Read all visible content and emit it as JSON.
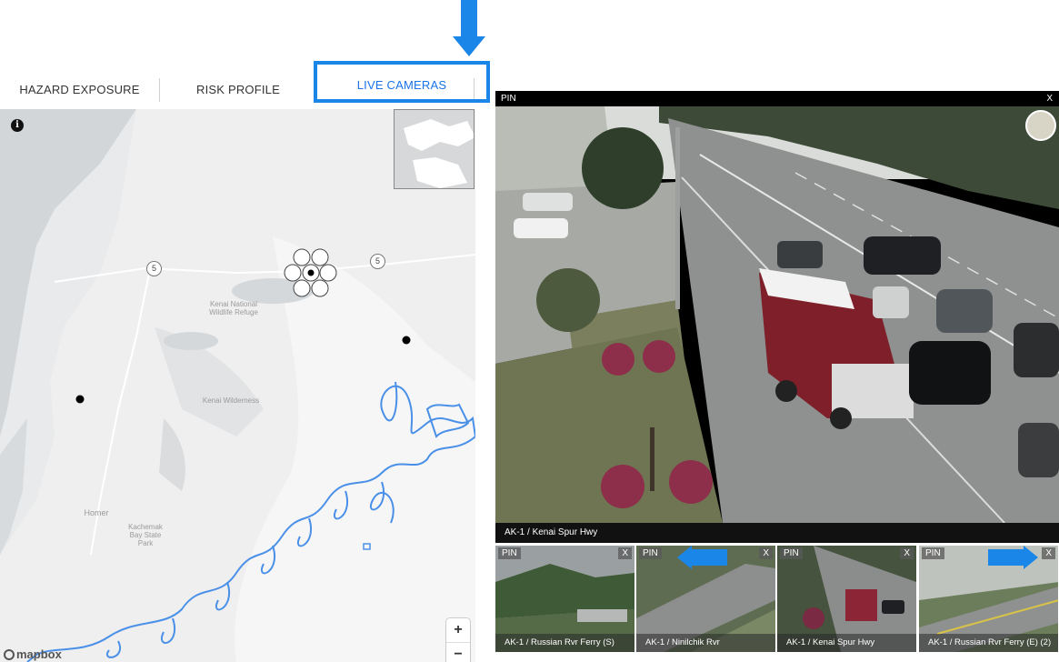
{
  "tabs": [
    {
      "label": "HAZARD EXPOSURE",
      "active": false
    },
    {
      "label": "RISK PROFILE",
      "active": false
    },
    {
      "label": "LIVE CAMERAS",
      "active": true
    }
  ],
  "map": {
    "labels": {
      "refuge": "Kenai National Wildlife Refuge",
      "wilderness": "Kenai Wilderness",
      "homer": "Homer",
      "kachemak": "Kachemak Bay State Park"
    },
    "route_shields": [
      "5",
      "5"
    ],
    "zoom_in": "+",
    "zoom_out": "−",
    "attribution": "mapbox",
    "info_icon": "info-icon"
  },
  "main_camera": {
    "pin_label": "PIN",
    "close_label": "X",
    "caption": "AK-1 / Kenai Spur Hwy"
  },
  "thumbnails": [
    {
      "pin": "PIN",
      "close": "X",
      "caption": "AK-1 / Russian Rvr Ferry (S)",
      "selected": false
    },
    {
      "pin": "PIN",
      "close": "X",
      "caption": "AK-1 / Ninilchik Rvr",
      "selected": false
    },
    {
      "pin": "PIN",
      "close": "X",
      "caption": "AK-1 / Kenai Spur Hwy",
      "selected": true
    },
    {
      "pin": "PIN",
      "close": "X",
      "caption": "AK-1 / Russian Rvr Ferry (E) (2)",
      "selected": false
    }
  ],
  "colors": {
    "accent": "#1a86e8",
    "coast": "#4a90e8",
    "water": "#cfd3d6",
    "land": "#eceded"
  }
}
